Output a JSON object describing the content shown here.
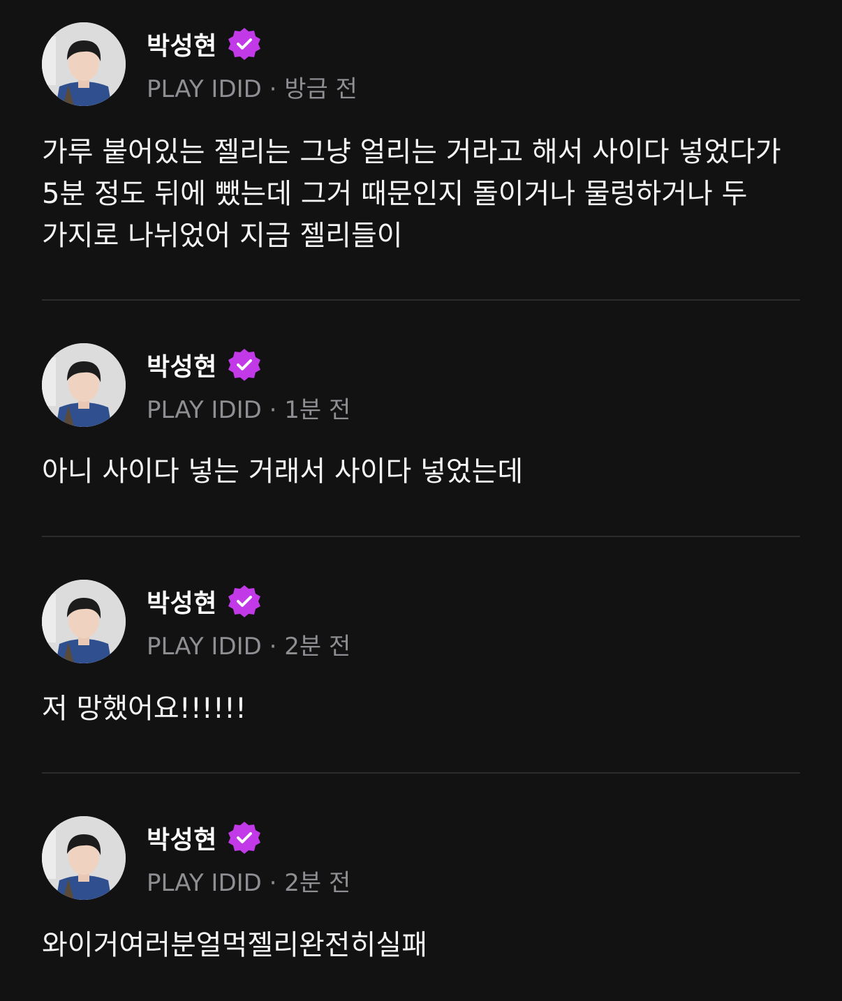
{
  "colors": {
    "background": "#121212",
    "meta_text": "#8e8e93",
    "verified_badge": "#c239e8",
    "divider": "#2c2c2e"
  },
  "posts": [
    {
      "author": "박성현",
      "source": "PLAY IDID",
      "separator": "·",
      "time": "방금 전",
      "body": "가루 붙어있는 젤리는 그냥 얼리는 거라고 해서 사이다 넣었다가 5분 정도 뒤에 뺐는데 그거 때문인지 돌이거나 물렁하거나 두 가지로 나뉘었어 지금 젤리들이"
    },
    {
      "author": "박성현",
      "source": "PLAY IDID",
      "separator": "·",
      "time": "1분 전",
      "body": "아니 사이다 넣는 거래서 사이다 넣었는데"
    },
    {
      "author": "박성현",
      "source": "PLAY IDID",
      "separator": "·",
      "time": "2분 전",
      "body": "저 망했어요!!!!!!"
    },
    {
      "author": "박성현",
      "source": "PLAY IDID",
      "separator": "·",
      "time": "2분 전",
      "body": "와이거여러분얼먹젤리완전히실패"
    }
  ]
}
